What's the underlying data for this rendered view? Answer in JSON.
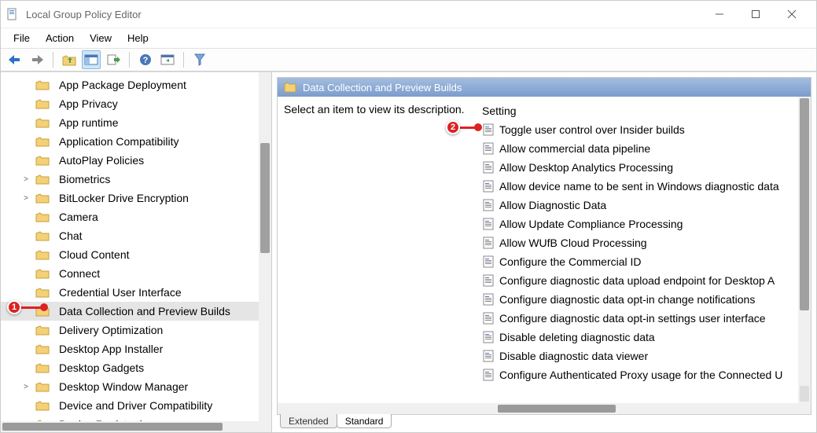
{
  "window": {
    "title": "Local Group Policy Editor"
  },
  "menu": {
    "file": "File",
    "action": "Action",
    "view": "View",
    "help": "Help"
  },
  "tree": {
    "items": [
      {
        "label": "App Package Deployment",
        "expander": ""
      },
      {
        "label": "App Privacy",
        "expander": ""
      },
      {
        "label": "App runtime",
        "expander": ""
      },
      {
        "label": "Application Compatibility",
        "expander": ""
      },
      {
        "label": "AutoPlay Policies",
        "expander": ""
      },
      {
        "label": "Biometrics",
        "expander": ">"
      },
      {
        "label": "BitLocker Drive Encryption",
        "expander": ">"
      },
      {
        "label": "Camera",
        "expander": ""
      },
      {
        "label": "Chat",
        "expander": ""
      },
      {
        "label": "Cloud Content",
        "expander": ""
      },
      {
        "label": "Connect",
        "expander": ""
      },
      {
        "label": "Credential User Interface",
        "expander": ""
      },
      {
        "label": "Data Collection and Preview Builds",
        "expander": "",
        "selected": true
      },
      {
        "label": "Delivery Optimization",
        "expander": ""
      },
      {
        "label": "Desktop App Installer",
        "expander": ""
      },
      {
        "label": "Desktop Gadgets",
        "expander": ""
      },
      {
        "label": "Desktop Window Manager",
        "expander": ">"
      },
      {
        "label": "Device and Driver Compatibility",
        "expander": ""
      },
      {
        "label": "Device Registration",
        "expander": ""
      }
    ]
  },
  "details": {
    "header": "Data Collection and Preview Builds",
    "description_prompt": "Select an item to view its description.",
    "column_header": "Setting",
    "settings": [
      "Toggle user control over Insider builds",
      "Allow commercial data pipeline",
      "Allow Desktop Analytics Processing",
      "Allow device name to be sent in Windows diagnostic data",
      "Allow Diagnostic Data",
      "Allow Update Compliance Processing",
      "Allow WUfB Cloud Processing",
      "Configure the Commercial ID",
      "Configure diagnostic data upload endpoint for Desktop A",
      "Configure diagnostic data opt-in change notifications",
      "Configure diagnostic data opt-in settings user interface",
      "Disable deleting diagnostic data",
      "Disable diagnostic data viewer",
      "Configure Authenticated Proxy usage for the Connected U"
    ]
  },
  "tabs": {
    "extended": "Extended",
    "standard": "Standard"
  },
  "callouts": {
    "one": "1",
    "two": "2"
  }
}
